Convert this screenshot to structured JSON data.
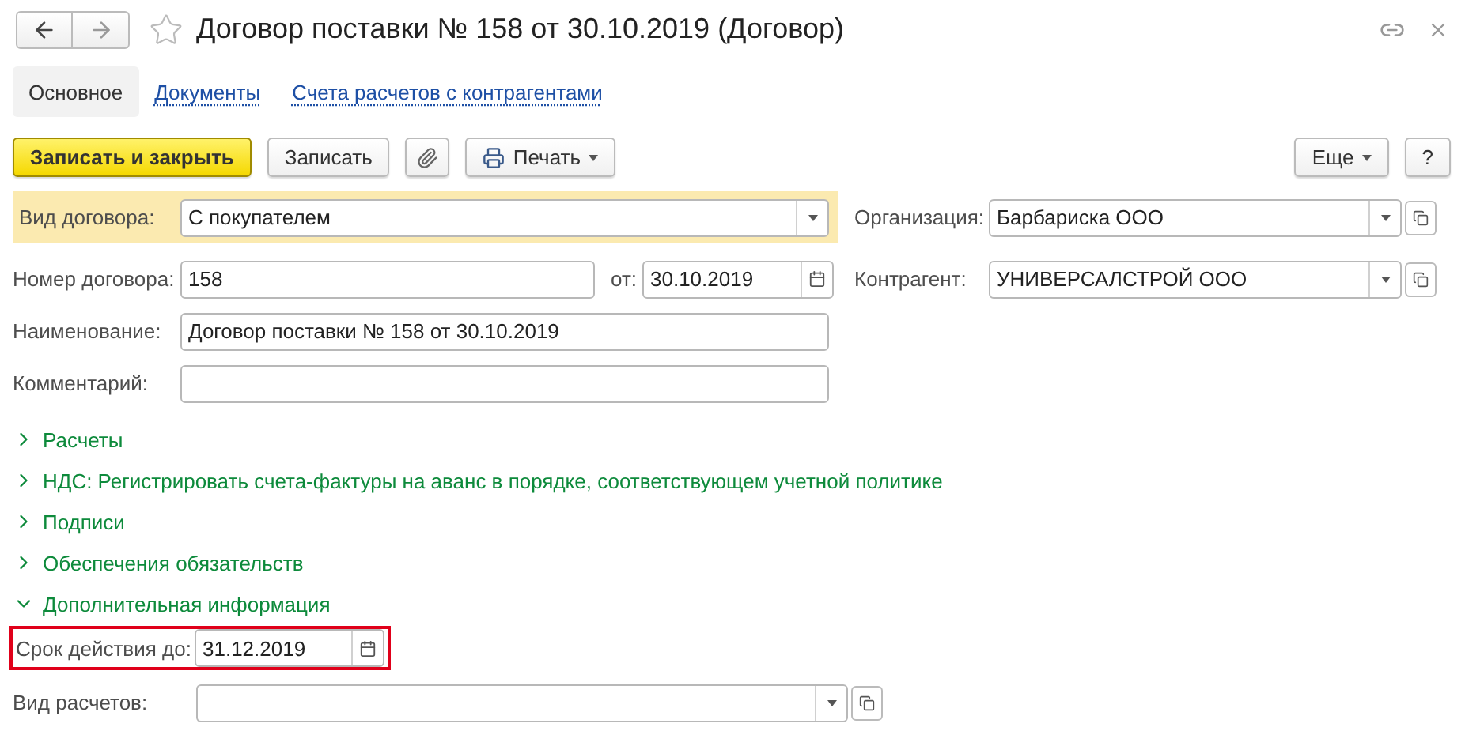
{
  "window": {
    "title": "Договор поставки № 158 от 30.10.2019 (Договор)"
  },
  "tabs": [
    {
      "label": "Основное",
      "selected": true
    },
    {
      "label": "Документы",
      "selected": false
    },
    {
      "label": "Счета расчетов с контрагентами",
      "selected": false
    }
  ],
  "toolbar": {
    "left": [
      {
        "kind": "primary",
        "label": "Записать и закрыть"
      },
      {
        "kind": "plain",
        "label": "Записать"
      },
      {
        "kind": "attach"
      },
      {
        "kind": "print",
        "label": "Печать"
      }
    ],
    "right": [
      {
        "kind": "menu",
        "label": "Еще"
      },
      {
        "kind": "plain",
        "label": "?"
      }
    ]
  },
  "main": {
    "contract_type": {
      "label": "Вид договора:",
      "value": "С покупателем",
      "highlighted": true
    },
    "organization": {
      "label": "Организация:",
      "value": "Барбариска ООО"
    },
    "number": {
      "label": "Номер договора:",
      "value": "158"
    },
    "date": {
      "label": "от:",
      "value": "30.10.2019"
    },
    "counterparty": {
      "label": "Контрагент:",
      "value": "УНИВЕРСАЛСТРОЙ ООО"
    },
    "name": {
      "label": "Наименование:",
      "value": "Договор поставки № 158 от 30.10.2019"
    },
    "comment": {
      "label": "Комментарий:"
    }
  },
  "sections": [
    {
      "label": "Расчеты",
      "expanded": false
    },
    {
      "label": "НДС: Регистрировать счета-фактуры на аванс в порядке, соответствующем учетной политике",
      "expanded": false
    },
    {
      "label": "Подписи",
      "expanded": false
    },
    {
      "label": "Обеспечения обязательств",
      "expanded": false
    },
    {
      "label": "Дополнительная информация",
      "expanded": true
    }
  ],
  "extra": {
    "valid_until": {
      "label": "Срок действия до:",
      "value": "31.12.2019",
      "highlighted": true
    },
    "settlement_type": {
      "label": "Вид расчетов:"
    }
  }
}
